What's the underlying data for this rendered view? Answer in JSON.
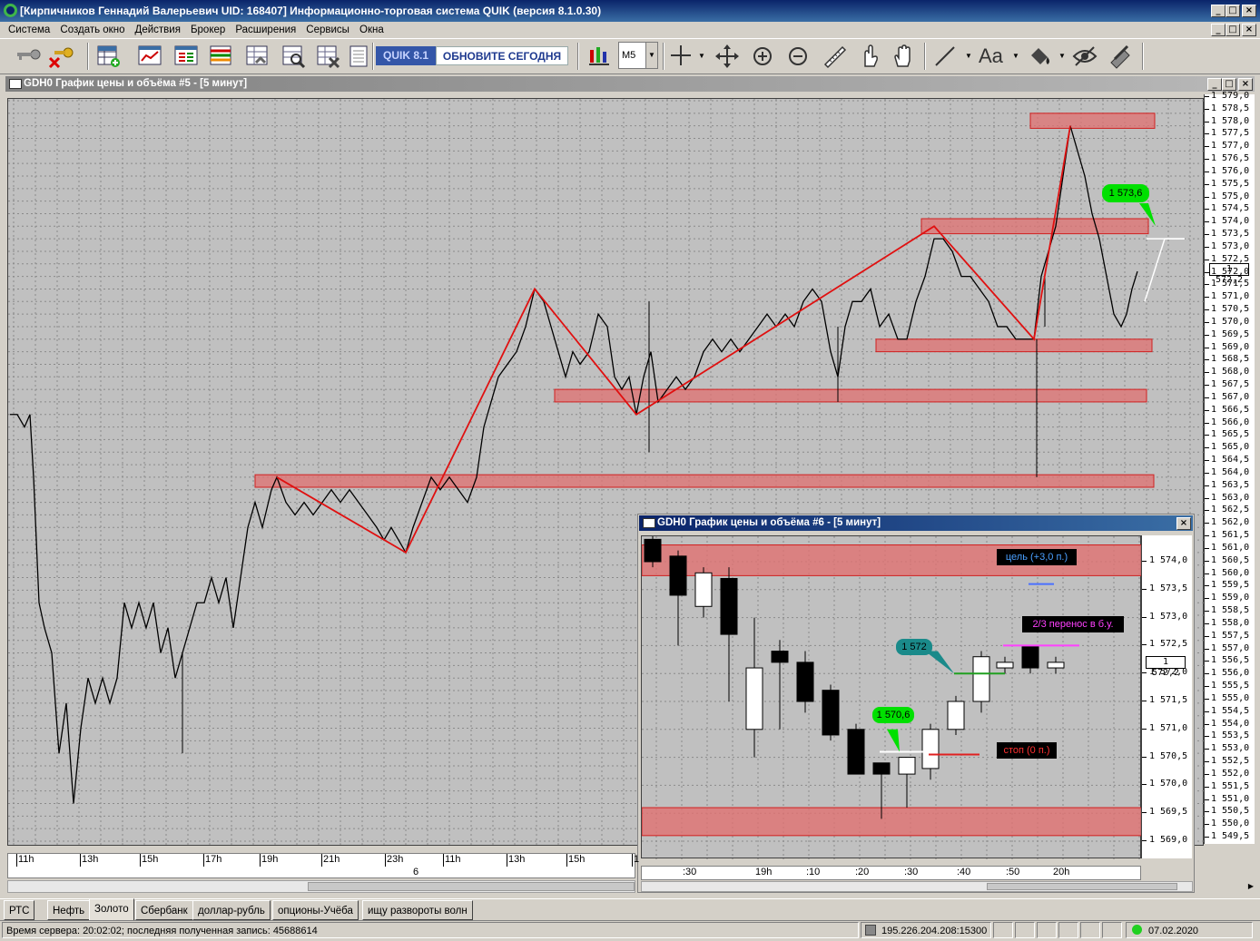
{
  "window": {
    "title": "[Кирпичников Геннадий Валерьевич UID: 168407] Информационно-торговая система QUIK (версия 8.1.0.30)"
  },
  "menu": [
    "Система",
    "Создать окно",
    "Действия",
    "Брокер",
    "Расширения",
    "Сервисы",
    "Окна"
  ],
  "toolbar": {
    "quik_label": "QUIK 8.1",
    "update_label": "ОБНОВИТЕ СЕГОДНЯ",
    "timeframe": "M5",
    "text_tool_label": "Aa"
  },
  "chart1": {
    "title": "GDH0 График цены и объёма #5 - [5 минут]",
    "current_price": "1 572,2",
    "price_labels": [
      "1 579,0",
      "1 578,5",
      "1 578,0",
      "1 577,5",
      "1 577,0",
      "1 576,5",
      "1 576,0",
      "1 575,5",
      "1 575,0",
      "1 574,5",
      "1 574,0",
      "1 573,5",
      "1 573,0",
      "1 572,5",
      "1 572,0",
      "1 571,5",
      "1 571,0",
      "1 570,5",
      "1 570,0",
      "1 569,5",
      "1 569,0",
      "1 568,5",
      "1 568,0",
      "1 567,5",
      "1 567,0",
      "1 566,5",
      "1 566,0",
      "1 565,5",
      "1 565,0",
      "1 564,5",
      "1 564,0",
      "1 563,5",
      "1 563,0",
      "1 562,5",
      "1 562,0",
      "1 561,5",
      "1 561,0",
      "1 560,5",
      "1 560,0",
      "1 559,5",
      "1 559,0",
      "1 558,5",
      "1 558,0",
      "1 557,5",
      "1 557,0",
      "1 556,5",
      "1 556,0",
      "1 555,5",
      "1 555,0",
      "1 554,5",
      "1 554,0",
      "1 553,5",
      "1 553,0",
      "1 552,5",
      "1 552,0",
      "1 551,5",
      "1 551,0",
      "1 550,5",
      "1 550,0",
      "1 549,5"
    ],
    "time_labels": [
      "11h",
      "13h",
      "15h",
      "17h",
      "19h",
      "21h",
      "23h",
      "11h",
      "13h",
      "15h",
      "1"
    ],
    "day_label": "6",
    "callout_label": "1 573,6",
    "colors": {
      "zone": "#e06060",
      "zigzag": "#e01010",
      "callout": "#00e000"
    }
  },
  "chart2": {
    "title": "GDH0 График цены и объёма #6 - [5 минут]",
    "current_price": "1 572,2",
    "price_labels": [
      "1 574,0",
      "1 573,5",
      "1 573,0",
      "1 572,5",
      "1 572,0",
      "1 571,5",
      "1 571,0",
      "1 570,5",
      "1 570,0",
      "1 569,5",
      "1 569,0"
    ],
    "time_labels": [
      ":30",
      "19h",
      ":10",
      ":20",
      ":30",
      ":40",
      ":50",
      "20h"
    ],
    "target_label": "цель (+3,0 п.)",
    "breakeven_label": "2/3 перенос в б.у.",
    "stop_label": "стоп (0 п.)",
    "entry_callout": "1 570,6",
    "level_callout": "1 572"
  },
  "tabs": [
    "РТС",
    "Нефть",
    "Золото",
    "Сбербанк",
    "доллар-рубль",
    "опционы-Учёба",
    "ищу развороты волн"
  ],
  "active_tab": "Золото",
  "status": {
    "server_time": "Время сервера: 20:02:02; последняя полученная запись: 45688614",
    "connection": "195.226.204.208:15300",
    "date": "07.02.2020"
  }
}
